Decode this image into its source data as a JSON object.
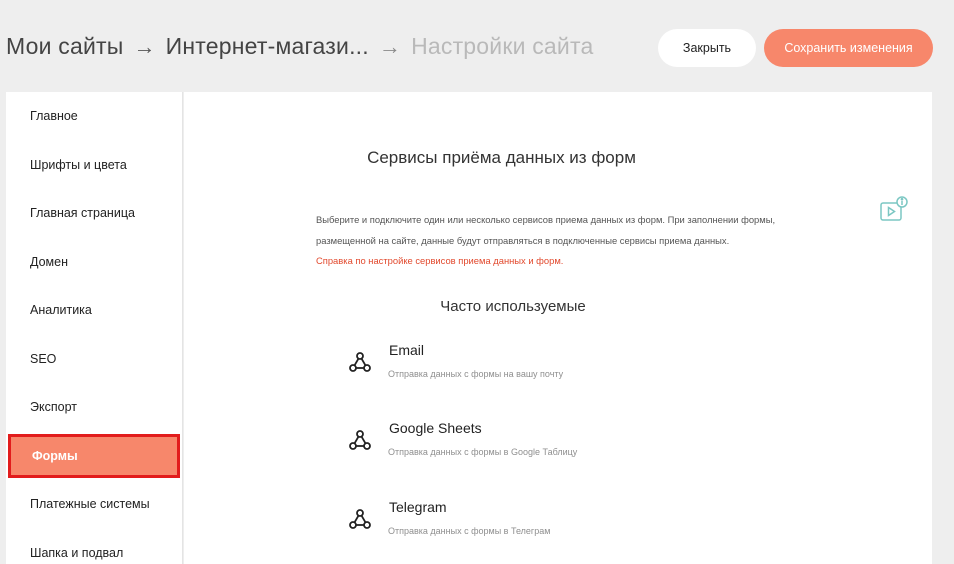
{
  "header": {
    "breadcrumb": [
      "Мои сайты",
      "Интернет-магази...",
      "Настройки сайта"
    ],
    "separator": "→",
    "close_label": "Закрыть",
    "save_label": "Сохранить изменения"
  },
  "sidebar": {
    "items": [
      {
        "label": "Главное"
      },
      {
        "label": "Шрифты и цвета"
      },
      {
        "label": "Главная страница"
      },
      {
        "label": "Домен"
      },
      {
        "label": "Аналитика"
      },
      {
        "label": "SEO"
      },
      {
        "label": "Экспорт"
      },
      {
        "label": "Формы",
        "active": true
      },
      {
        "label": "Платежные системы"
      },
      {
        "label": "Шапка и подвал"
      }
    ]
  },
  "main": {
    "title": "Сервисы приёма данных из форм",
    "description": "Выберите и подключите один или несколько сервисов приема данных из форм. При заполнении формы, размещенной на сайте, данные будут отправляться в подключенные сервисы приема данных.",
    "help_link": "Справка по настройке сервисов приема данных и форм.",
    "section_title": "Часто используемые",
    "services": [
      {
        "name": "Email",
        "description": "Отправка данных с формы на вашу почту"
      },
      {
        "name": "Google Sheets",
        "description": "Отправка данных с формы в Google Таблицу"
      },
      {
        "name": "Telegram",
        "description": "Отправка данных с формы в Телеграм"
      }
    ]
  },
  "colors": {
    "accent": "#f7876b",
    "highlight_border": "#e21c1c",
    "link": "#e2492d",
    "video_icon": "#7cc7c3"
  },
  "icons": {
    "service": "share-nodes-icon",
    "video_info": "video-info-icon"
  }
}
